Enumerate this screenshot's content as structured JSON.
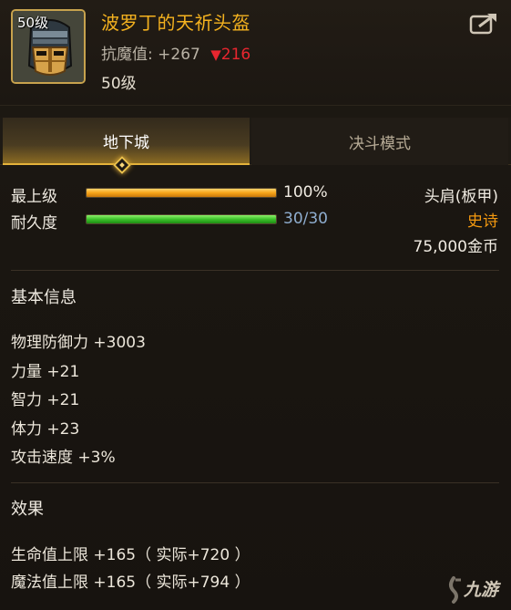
{
  "item": {
    "level_badge": "50级",
    "name": "波罗丁的天祈头盔",
    "resist_label": "抗魔值:",
    "resist_value": "+267",
    "resist_arrow": "▼",
    "resist_change": "216",
    "level": "50级",
    "icon": "helmet-icon"
  },
  "header": {
    "share_icon": "share-icon"
  },
  "tabs": [
    {
      "label": "地下城",
      "active": true
    },
    {
      "label": "决斗模式",
      "active": false
    }
  ],
  "bars": {
    "grade": {
      "label": "最上级",
      "value_text": "100%",
      "fraction": 1.0,
      "color": "#f6a419"
    },
    "durability": {
      "label": "耐久度",
      "value_text": "30/30",
      "fraction": 1.0,
      "color": "#3cc12b"
    }
  },
  "info": {
    "slot": "头肩(板甲)",
    "rarity": "史诗",
    "rarity_color": "#f59a10",
    "price": "75,000金币"
  },
  "basic": {
    "title": "基本信息",
    "attrs": [
      "物理防御力 +3003",
      "力量 +21",
      "智力 +21",
      "体力 +23",
      "攻击速度 +3%"
    ]
  },
  "effects": {
    "title": "效果",
    "lines": [
      "生命值上限 +165（ 实际+720 ）",
      "魔法值上限 +165（ 实际+794 ）"
    ]
  },
  "watermark": {
    "text": "九游"
  },
  "colors": {
    "name": "#f4b21f",
    "accent": "#e4b23a",
    "down": "#e8262f"
  }
}
